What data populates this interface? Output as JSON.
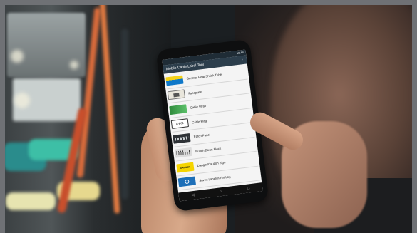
{
  "app": {
    "title": "Mobile Cable Label Tool",
    "status_time": "10:48"
  },
  "list_items": [
    {
      "label": "General Heat Shrink Tube",
      "icon": "heat-shrink-tube-icon"
    },
    {
      "label": "Faceplate",
      "icon": "faceplate-icon"
    },
    {
      "label": "Cable Wrap",
      "icon": "cable-wrap-icon"
    },
    {
      "label": "Cable Flag",
      "icon": "cable-flag-icon",
      "icon_text": "A-B01"
    },
    {
      "label": "Patch Panel",
      "icon": "patch-panel-icon"
    },
    {
      "label": "Punch Down Block",
      "icon": "punch-down-block-icon"
    },
    {
      "label": "Danger/Caution Sign",
      "icon": "danger-sign-icon",
      "icon_text": "DANGER"
    },
    {
      "label": "Saved Labels/Print Log",
      "icon": "saved-labels-icon"
    }
  ],
  "nav": {
    "back": "◁",
    "home": "○",
    "recent": "□"
  },
  "menu_glyph": "⋮"
}
